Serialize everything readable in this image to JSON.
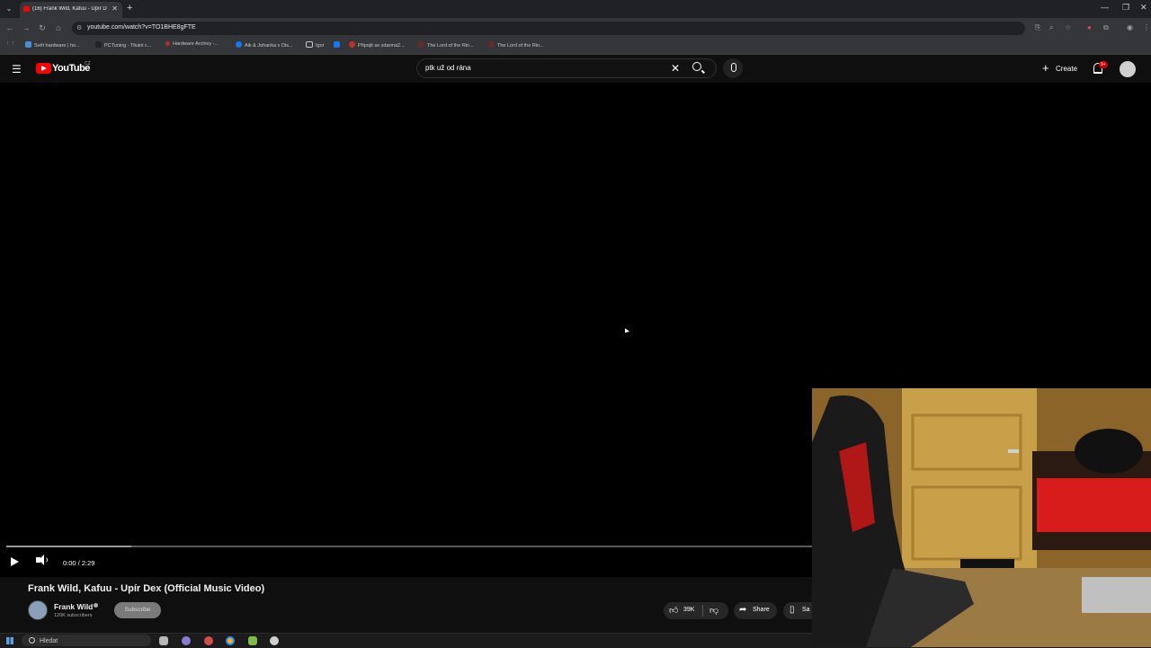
{
  "browser": {
    "tab_title": "(16) Frank Wild, Kafuu - Upír D",
    "new_tab": "+",
    "url": "youtube.com/watch?v=TO1BHE8gFTE",
    "bookmarks": [
      {
        "label": "Svět hardware | ho...",
        "color": "#4a8fd4"
      },
      {
        "label": "PCTuning - Tituini c...",
        "color": "#222222"
      },
      {
        "label": "Hardware Archivy -...",
        "color": "#b0302a"
      },
      {
        "label": "Aik & Johanka v Dis...",
        "color": "#1877f2"
      },
      {
        "label": "Igor",
        "color": "#777777"
      },
      {
        "label": "Připojit se zdarma2...",
        "color": "#c0302a"
      },
      {
        "label": "The Lord of the Rin...",
        "color": "#6a2a2a"
      },
      {
        "label": "The Lord of the Rin...",
        "color": "#6a2a2a"
      }
    ]
  },
  "youtube": {
    "logo_text": "YouTube",
    "region": "CZ",
    "search_query": "ptk už od rána",
    "create_label": "Create",
    "notification_count": "9+"
  },
  "player": {
    "time": "0:00 / 2:29",
    "buffered_fraction": 0.11,
    "played_fraction": 0
  },
  "video": {
    "title": "Frank Wild, Kafuu - Upír Dex (Official Music Video)",
    "channel": "Frank Wild",
    "subscribers": "120K subscribers",
    "subscribe_label": "Subscribe",
    "likes": "39K",
    "share_label": "Share",
    "save_label": "Sa"
  },
  "taskbar": {
    "search_label": "Hledat",
    "apps": [
      {
        "name": "app-1",
        "color": "#b8b8b8"
      },
      {
        "name": "app-2",
        "color": "#8a7ad0"
      },
      {
        "name": "app-3",
        "color": "#d44d4d"
      },
      {
        "name": "chrome",
        "color": "#e8b23a"
      },
      {
        "name": "app-5",
        "color": "#7fba4a"
      },
      {
        "name": "app-6",
        "color": "#d0d0d0"
      }
    ]
  }
}
